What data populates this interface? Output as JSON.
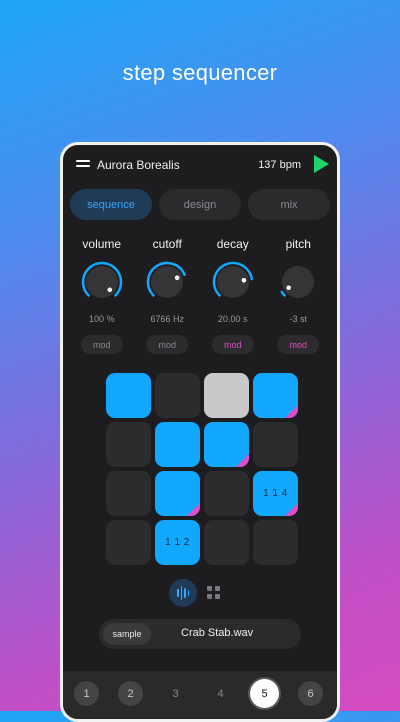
{
  "headline": "step sequencer",
  "header": {
    "title": "Aurora Borealis",
    "bpm": "137 bpm"
  },
  "tabs": [
    {
      "label": "sequence",
      "active": true
    },
    {
      "label": "design",
      "active": false
    },
    {
      "label": "mix",
      "active": false
    }
  ],
  "knobs": [
    {
      "label": "volume",
      "value": "100 %",
      "level": 1.0,
      "mod": "mod",
      "mod_active": false
    },
    {
      "label": "cutoff",
      "value": "6766 Hz",
      "level": 0.75,
      "mod": "mod",
      "mod_active": false
    },
    {
      "label": "decay",
      "value": "20.00 s",
      "level": 0.8,
      "mod": "mod",
      "mod_active": true
    },
    {
      "label": "pitch",
      "value": "-3 st",
      "level": 0.05,
      "mod": "mod",
      "mod_active": true
    }
  ],
  "pads": {
    "rows": [
      [
        {
          "state": "on",
          "mod": false,
          "label": ""
        },
        {
          "state": "off",
          "mod": false,
          "label": ""
        },
        {
          "state": "playing",
          "mod": false,
          "label": ""
        },
        {
          "state": "on",
          "mod": true,
          "label": ""
        }
      ],
      [
        {
          "state": "off",
          "mod": false,
          "label": ""
        },
        {
          "state": "on",
          "mod": false,
          "label": ""
        },
        {
          "state": "on",
          "mod": true,
          "label": ""
        },
        {
          "state": "off",
          "mod": false,
          "label": ""
        }
      ],
      [
        {
          "state": "off",
          "mod": false,
          "label": ""
        },
        {
          "state": "on",
          "mod": true,
          "label": ""
        },
        {
          "state": "off",
          "mod": false,
          "label": ""
        },
        {
          "state": "on",
          "mod": true,
          "label": "1 1 4"
        }
      ],
      [
        {
          "state": "off",
          "mod": false,
          "label": ""
        },
        {
          "state": "on",
          "mod": false,
          "label": "1 1 2"
        },
        {
          "state": "off",
          "mod": false,
          "label": ""
        },
        {
          "state": "off",
          "mod": false,
          "label": ""
        }
      ]
    ]
  },
  "view_toggle": {
    "active": "waveform"
  },
  "sample": {
    "tag": "sample",
    "name": "Crab Stab.wav"
  },
  "pages": [
    {
      "label": "1",
      "style": "filled"
    },
    {
      "label": "2",
      "style": "filled"
    },
    {
      "label": "3",
      "style": "plain"
    },
    {
      "label": "4",
      "style": "plain"
    },
    {
      "label": "5",
      "style": "active"
    },
    {
      "label": "6",
      "style": "filled"
    }
  ],
  "colors": {
    "accent": "#13a8ff",
    "mod": "#e04ec6",
    "play": "#21d16a"
  }
}
